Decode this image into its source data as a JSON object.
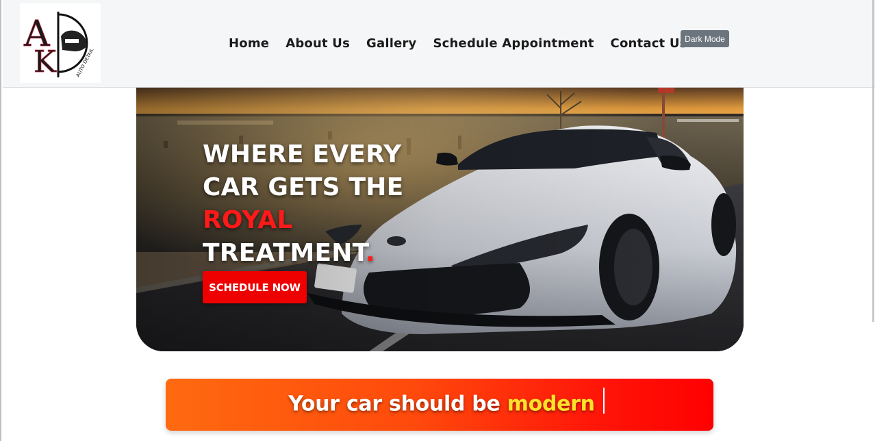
{
  "header": {
    "logo": {
      "letters": [
        "A",
        "K"
      ],
      "tagline": "AUTO DETAIL"
    },
    "nav": [
      {
        "label": "Home"
      },
      {
        "label": "About Us"
      },
      {
        "label": "Gallery"
      },
      {
        "label": "Schedule Appointment"
      },
      {
        "label": "Contact Us"
      }
    ],
    "dark_mode_label": "Dark Mode"
  },
  "hero": {
    "headline_line1": "WHERE EVERY",
    "headline_line2": "CAR GETS THE",
    "headline_accent": "ROYAL",
    "headline_line4": "TREATMENT",
    "headline_dot": ".",
    "cta_label": "SCHEDULE NOW",
    "image_subject": "white-sports-car-at-sunset"
  },
  "banner": {
    "prefix": "Your car should be ",
    "highlight": "modern"
  },
  "colors": {
    "accent_red": "#ee0000",
    "highlight_yellow": "#ffe229",
    "header_bg": "#f5f6f8",
    "dark_mode_button": "#6c757d"
  }
}
